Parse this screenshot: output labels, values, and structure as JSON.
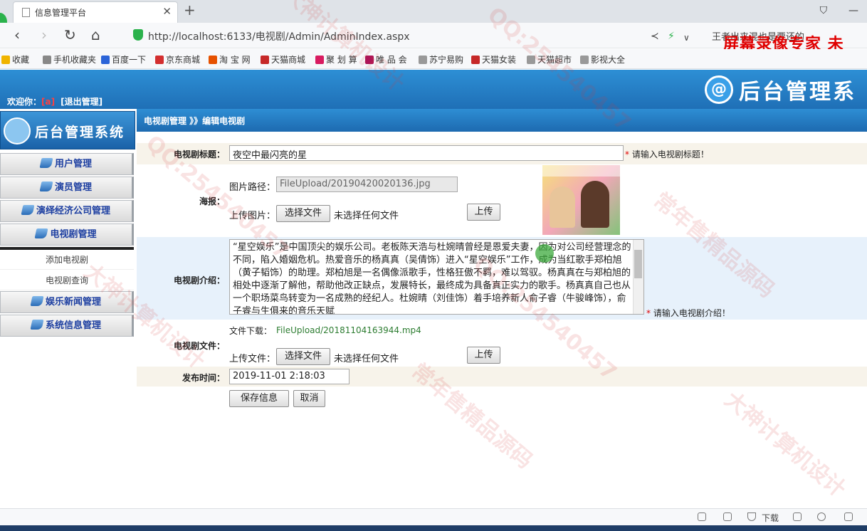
{
  "browser": {
    "tab_title": "信息管理平台",
    "new_tab": "+",
    "url": "http://localhost:6133/电视剧/Admin/AdminIndex.aspx",
    "search_text": "王者出来混也是要还的",
    "window_controls": [
      "⛉",
      "—"
    ]
  },
  "overlay": {
    "recorder_text": "屏幕录像专家  未"
  },
  "bookmarks": [
    {
      "label": "收藏",
      "color": "#f0b400"
    },
    {
      "label": "手机收藏夹",
      "color": "#888888"
    },
    {
      "label": "百度一下",
      "color": "#2b64d8"
    },
    {
      "label": "京东商城",
      "color": "#d32f2f"
    },
    {
      "label": "淘 宝 网",
      "color": "#e65100"
    },
    {
      "label": "天猫商城",
      "color": "#c62828"
    },
    {
      "label": "聚 划 算",
      "color": "#d81b60"
    },
    {
      "label": "唯 品 会",
      "color": "#ad1457"
    },
    {
      "label": "苏宁易购",
      "color": "#999999"
    },
    {
      "label": "天猫女装",
      "color": "#c62828"
    },
    {
      "label": "天猫超市",
      "color": "#999999"
    },
    {
      "label": "影视大全",
      "color": "#999999"
    }
  ],
  "header": {
    "welcome": "欢迎你：",
    "username": "[a]",
    "logout": "[退出管理]",
    "logo_mark": "@",
    "logo_text": "后台管理系"
  },
  "sidebar": {
    "logo_text": "后台管理系统",
    "menu": {
      "users": "用户管理",
      "actors": "演员管理",
      "companies": "演绎经济公司管理",
      "tv": "电视剧管理",
      "tv_add": "添加电视剧",
      "tv_query": "电视剧查询",
      "news": "娱乐新闻管理",
      "system": "系统信息管理"
    }
  },
  "breadcrumb": "电视剧管理 》》编辑电视剧",
  "form": {
    "title_label": "电视剧标题：",
    "title_value": "夜空中最闪亮的星",
    "title_hint": "请输入电视剧标题！",
    "poster_label": "海报：",
    "image_path_label": "图片路径：",
    "image_path_value": "FileUpload/20190420020136.jpg",
    "upload_image_label": "上传图片：",
    "choose_file": "选择文件",
    "no_file": "未选择任何文件",
    "upload": "上传",
    "intro_label": "电视剧介绍：",
    "intro_value": "“星空娱乐”是中国顶尖的娱乐公司。老板陈天浩与杜婉晴曾经是恩爱夫妻，因为对公司经营理念的不同，陷入婚姻危机。热爱音乐的杨真真（吴倩饰）进入“星空娱乐”工作，成为当红歌手郑柏旭（黄子韬饰）的助理。郑柏旭是一名偶像派歌手，性格狂傲不羁，难以驾驭。杨真真在与郑柏旭的相处中逐渐了解他，帮助他改正缺点，发展特长，最终成为具备真正实力的歌手。杨真真自己也从一个职场菜鸟转变为一名成熟的经纪人。杜婉晴（刘佳饰）着手培养新人俞子睿（牛骏峰饰），俞子睿与生俱来的音乐天赋",
    "intro_hint": "请输入电视剧介绍！",
    "file_label": "电视剧文件：",
    "file_download_label": "文件下载：",
    "file_download_link": "FileUpload/20181104163944.mp4",
    "upload_file_label": "上传文件：",
    "date_label": "发布时间：",
    "date_value": "2019-11-01 2:18:03",
    "save": "保存信息",
    "cancel": "取消"
  },
  "statusbar": {
    "download": "下载"
  },
  "watermark": [
    "大神计算机设计",
    "QQ:254540457",
    "常年售精品源码",
    "大神计算机设计",
    "QQ:254540457",
    "常年售精品源码",
    "大神计算机设计",
    "QQ:254540457"
  ]
}
